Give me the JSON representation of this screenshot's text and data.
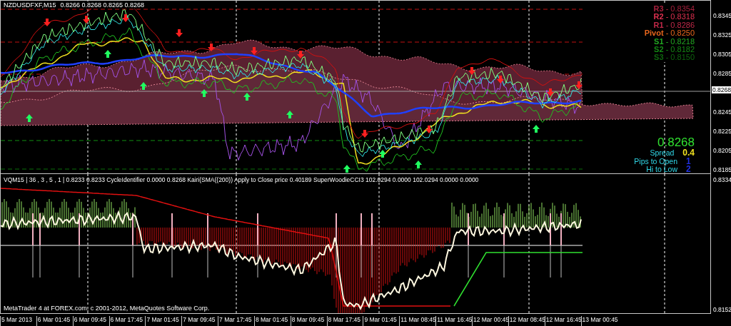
{
  "chart": {
    "symbol": "NZDUSDFXF,M15",
    "ohlc": [
      "0.8266",
      "0.8268",
      "0.8265",
      "0.8268"
    ],
    "pivots": [
      {
        "text": "**R3** - 0.8354",
        "color": "#a8203c"
      },
      {
        "text": "**R2** - 0.8318",
        "color": "#e03050"
      },
      {
        "text": "**R1** - 0.8286",
        "color": "#c02848"
      },
      {
        "text": "**Pivot** - 0.8250",
        "color": "#e8661c"
      },
      {
        "text": "**S1** - 0.8218",
        "color": "#22a822"
      },
      {
        "text": "**S2** - 0.8182",
        "color": "#148a14"
      },
      {
        "text": "**S3** - 0.8150",
        "color": "#0e640e"
      }
    ],
    "price": "0.8268",
    "stats": [
      {
        "label": "Spread",
        "value": "0.4",
        "color": "#f0e020"
      },
      {
        "label": "Pips to Open",
        "value": "1",
        "color": "#2030e0"
      },
      {
        "label": "Hi to Low",
        "value": "2",
        "color": "#2030e0"
      }
    ],
    "price_axis": [
      "0.8345",
      "0.8325",
      "0.8305",
      "0.8285",
      "0.8245",
      "0.8225",
      "0.8205",
      "0.8185"
    ],
    "current_price_tag": "0.8268"
  },
  "indicator": {
    "header": "VQM15 | 36 , 3 , 5 , 1 | 0.8233 0.8233 CycleIdentifier 0.0000 0.8268 Kairi(SMA((200)) Apply to Close price 0.40189 SuperWoodieCCI3 102.0294 0.0000 102.0294 0.0000 0.0000",
    "axis": [
      "0.8334",
      "0.8152"
    ],
    "copyright": "MetaTrader 4 at FOREX.com, c 2001-2012, MetaQuotes Software Corp."
  },
  "time_axis": [
    "5 Mar 2013",
    "6 Mar 01:45",
    "6 Mar 09:45",
    "6 Mar 17:45",
    "7 Mar 01:45",
    "7 Mar 09:45",
    "7 Mar 17:45",
    "8 Mar 01:45",
    "8 Mar 09:45",
    "8 Mar 17:45",
    "9 Mar 01:45",
    "11 Mar 08:45",
    "11 Mar 16:45",
    "12 Mar 00:45",
    "12 Mar 08:45",
    "12 Mar 16:45",
    "13 Mar 00:45"
  ]
}
